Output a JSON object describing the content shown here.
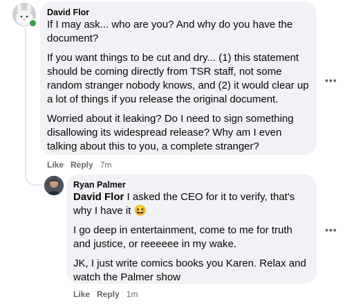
{
  "comment1": {
    "author": "David Flor",
    "paragraphs": [
      "If I may ask... who are you? And why do you have the document?",
      "If you want things to be cut and dry... (1) this statement should be coming directly from TSR staff, not some random stranger nobody knows, and (2) it would clear up a lot of things if you release the original document.",
      "Worried about it leaking? Do I need to sign something disallowing its widespread release? Why am I even talking about this to you, a complete stranger?"
    ],
    "actions": {
      "like": "Like",
      "reply": "Reply",
      "time": "7m"
    },
    "more": "•••"
  },
  "comment2": {
    "author": "Ryan Palmer",
    "mention": "David Flor",
    "first_text": " I asked the CEO for it to verify, that's why I have it ",
    "emoji": "😆",
    "paragraphs": [
      "I go deep in entertainment, come to me for truth and justice, or reeeeee in my wake.",
      "JK, I just write comics books you Karen. Relax and watch the Palmer show"
    ],
    "actions": {
      "like": "Like",
      "reply": "Reply",
      "time": "1m"
    },
    "more": "•••"
  }
}
